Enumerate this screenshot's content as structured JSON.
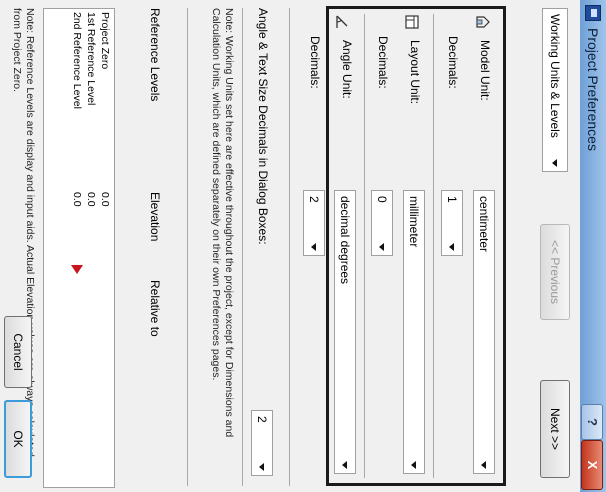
{
  "window": {
    "title": "Project Preferences",
    "help_label": "?",
    "close_label": "X"
  },
  "nav": {
    "section": "Working Units & Levels",
    "previous_label": "<< Previous",
    "next_label": "Next >>"
  },
  "units": {
    "model_unit_label": "Model Unit:",
    "model_unit_value": "centimeter",
    "model_decimals_label": "Decimals:",
    "model_decimals_value": "1",
    "layout_unit_label": "Layout Unit:",
    "layout_unit_value": "millimeter",
    "layout_decimals_label": "Decimals:",
    "layout_decimals_value": "0",
    "angle_unit_label": "Angle Unit:",
    "angle_unit_value": "decimal degrees",
    "angle_decimals_label": "Decimals:",
    "angle_decimals_value": "2"
  },
  "dialog_decimals": {
    "label": "Angle & Text Size Decimals in Dialog Boxes:",
    "value": "2"
  },
  "note_units": "Note: Working Units set here are effective throughout the project, except for Dimensions and Calculation Units, which are defined separately on their own Preferences pages.",
  "levels": {
    "title": "Reference Levels",
    "col_elevation": "Elevation",
    "col_relative": "Relative to",
    "rows": [
      {
        "name": "Project Zero",
        "elevation": "0.0"
      },
      {
        "name": "1st Reference Level",
        "elevation": "0.0"
      },
      {
        "name": "2nd Reference Level",
        "elevation": "0.0"
      }
    ]
  },
  "note_levels": "Note: Reference Levels are display and input aids. Actual Elevation values are always calculated from Project Zero.",
  "footer": {
    "cancel_label": "Cancel",
    "ok_label": "OK"
  }
}
